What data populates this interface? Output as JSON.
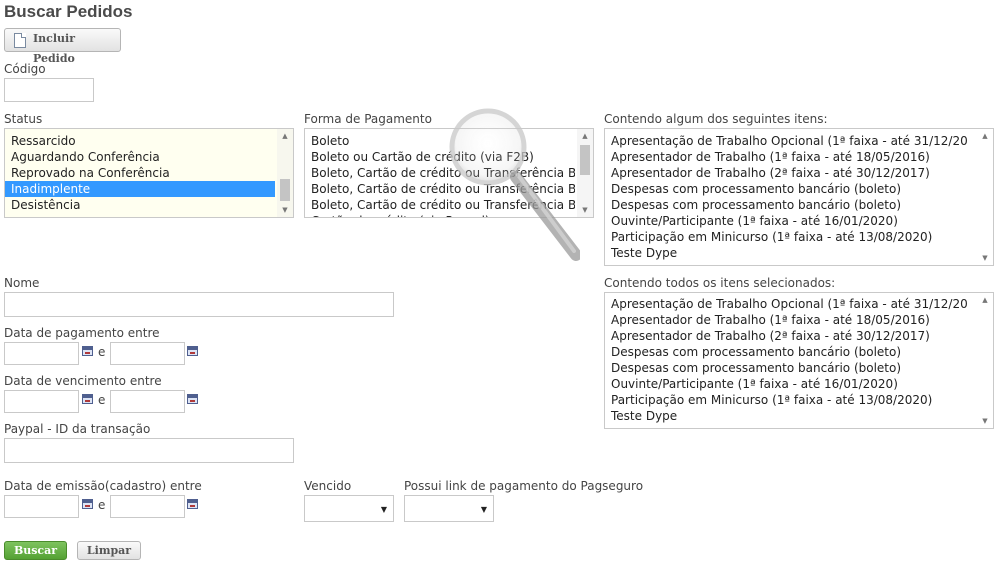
{
  "page": {
    "title": "Buscar Pedidos"
  },
  "toolbar": {
    "incluir_label": "Incluir Pedido"
  },
  "codigo": {
    "label": "Código",
    "value": ""
  },
  "status": {
    "label": "Status",
    "options": [
      "Ressarcido",
      "Aguardando Conferência",
      "Reprovado na Conferência",
      "Inadimplente",
      "Desistência"
    ],
    "selected": "Inadimplente"
  },
  "forma_pagamento": {
    "label": "Forma de Pagamento",
    "options": [
      "Boleto",
      "Boleto ou Cartão de crédito (via F2B)",
      "Boleto, Cartão de crédito ou Transferência B",
      "Boleto, Cartão de crédito ou Transferência B",
      "Boleto, Cartão de crédito ou Transferência B",
      "Cartão de crédito (via Paypal)"
    ]
  },
  "algum_itens": {
    "label": "Contendo algum dos seguintes itens:",
    "options": [
      "Apresentação de Trabalho Opcional (1ª faixa - até 31/12/20",
      "Apresentador de Trabalho (1ª faixa - até 18/05/2016)",
      "Apresentador de Trabalho (2ª faixa - até 30/12/2017)",
      "Despesas com processamento bancário (boleto)",
      "Despesas com processamento bancário (boleto)",
      "Ouvinte/Participante (1ª faixa - até 16/01/2020)",
      "Participação em Minicurso (1ª faixa - até 13/08/2020)",
      "Teste Dype"
    ]
  },
  "todos_itens": {
    "label": "Contendo todos os itens selecionados:",
    "options": [
      "Apresentação de Trabalho Opcional (1ª faixa - até 31/12/20",
      "Apresentador de Trabalho (1ª faixa - até 18/05/2016)",
      "Apresentador de Trabalho (2ª faixa - até 30/12/2017)",
      "Despesas com processamento bancário (boleto)",
      "Despesas com processamento bancário (boleto)",
      "Ouvinte/Participante (1ª faixa - até 16/01/2020)",
      "Participação em Minicurso (1ª faixa - até 13/08/2020)",
      "Teste Dype"
    ]
  },
  "nome": {
    "label": "Nome",
    "value": ""
  },
  "data_pagamento": {
    "label": "Data de pagamento entre",
    "between": "e",
    "from": "",
    "to": ""
  },
  "data_vencimento": {
    "label": "Data de vencimento entre",
    "between": "e",
    "from": "",
    "to": ""
  },
  "paypal": {
    "label": "Paypal - ID da transação",
    "value": ""
  },
  "data_emissao": {
    "label": "Data de emissão(cadastro) entre",
    "between": "e",
    "from": "",
    "to": ""
  },
  "vencido": {
    "label": "Vencido",
    "value": ""
  },
  "pagseguro": {
    "label": "Possui link de pagamento do Pagseguro",
    "value": ""
  },
  "actions": {
    "buscar_label": "Buscar",
    "limpar_label": "Limpar"
  },
  "icons": {
    "document": "document-icon",
    "calendar": "calendar-icon",
    "magnifier": "magnifier-icon"
  }
}
